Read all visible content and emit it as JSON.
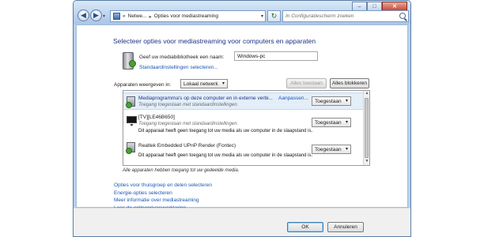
{
  "titlebar": {
    "caption_minimize": "–",
    "caption_maximize": "□",
    "caption_close": "✕"
  },
  "nav": {
    "back_icon": "back-arrow-icon",
    "forward_icon": "forward-arrow-icon",
    "breadcrumb": [
      "Netwe...",
      "Opties voor mediastreaming"
    ],
    "breadcrumb_prefix": "«",
    "separator": "▸",
    "search_placeholder": "In Configuratiescherm zoeken"
  },
  "main": {
    "heading": "Selecteer opties voor mediastreaming voor computers en apparaten",
    "library_label": "Geef uw mediabibliotheek een naam:",
    "library_value": "Windows-pc",
    "library_link": "Standaardinstellingen selecteren...",
    "show_label": "Apparaten weergeven in:",
    "network_select": "Lokaal netwerk",
    "allow_all": "Alles toestaan",
    "block_all": "Alles blokkeren"
  },
  "devices": [
    {
      "name": "Mediaprogramma's op deze computer en in externe verbi...",
      "sub": "Toegang toegestaan met standaardinstellingen.",
      "warn": "",
      "customize": "Aanpassen...",
      "status": "Toegestaan",
      "icon": "media-pc-icon"
    },
    {
      "name": "[TV][LE46B650]",
      "sub": "Toegang toegestaan met standaardinstellingen.",
      "warn": "Dit apparaat heeft geen toegang tot uw media als uw computer in de slaapstand is.",
      "customize": "",
      "status": "Toegestaan",
      "icon": "tv-icon"
    },
    {
      "name": "Realtek Embedded UPnP Render (Fontec)",
      "sub": "",
      "warn": "Dit apparaat heeft geen toegang tot uw media als uw computer in de slaapstand is.",
      "customize": "",
      "status": "Toegestaan",
      "icon": "media-renderer-icon"
    }
  ],
  "note": "Alle apparaten hebben toegang tot uw gedeelde media.",
  "links": [
    "Opties voor thuisgroep en delen selecteren",
    "Energie-opties selecteren",
    "Meer informatie over mediastreaming",
    "Lees de onlineprivacyverklaring"
  ],
  "footer": {
    "ok": "OK",
    "cancel": "Annuleren"
  }
}
